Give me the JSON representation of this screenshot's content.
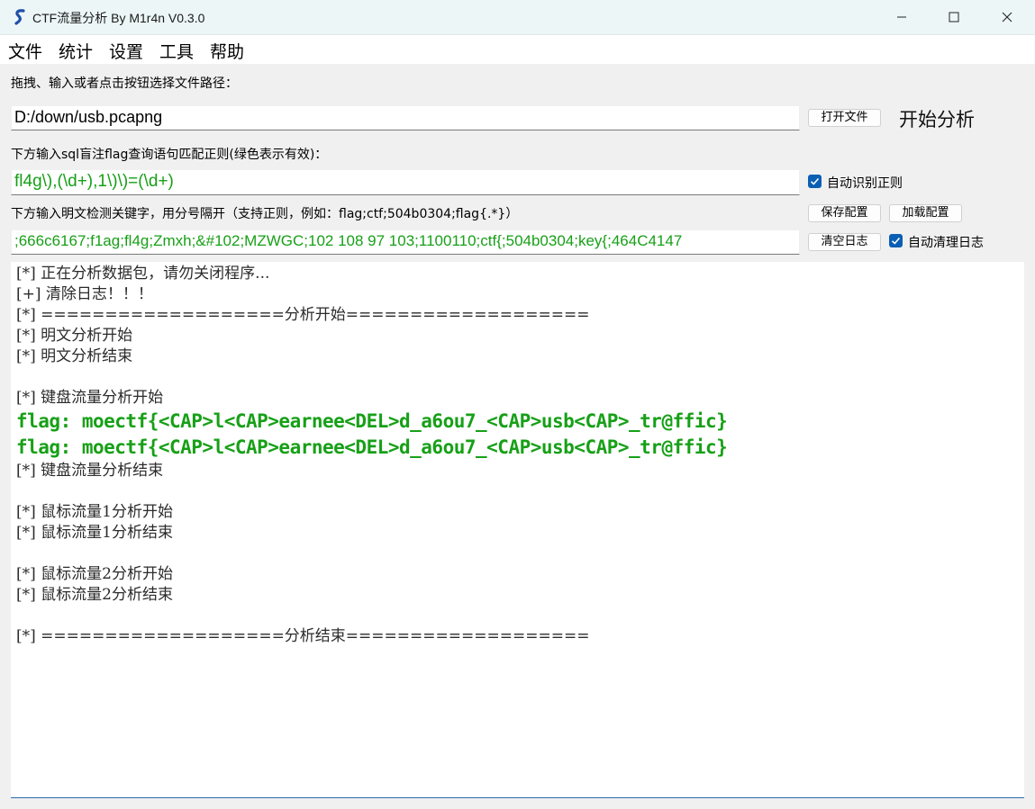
{
  "window": {
    "title": "CTF流量分析 By M1r4n V0.3.0",
    "controls": [
      "minimize",
      "maximize",
      "close"
    ]
  },
  "menu": {
    "items": [
      "文件",
      "统计",
      "设置",
      "工具",
      "帮助"
    ]
  },
  "file_section": {
    "label": "拖拽、输入或者点击按钮选择文件路径：",
    "path_value": "D:/down/usb.pcapng",
    "open_button": "打开文件",
    "start_button": "开始分析"
  },
  "sql_section": {
    "label": "下方输入sql盲注flag查询语句匹配正则(绿色表示有效)：",
    "regex_value": "fl4g\\),(\\d+),1\\)\\)=(\\d+)",
    "auto_regex_label": "自动识别正则",
    "auto_regex_checked": true
  },
  "keyword_section": {
    "label": "下方输入明文检测关键字，用分号隔开（支持正则，例如：flag;ctf;504b0304;flag{.*}）",
    "save_button": "保存配置",
    "load_button": "加载配置",
    "keywords_value": ";666c6167;f1ag;fl4g;Zmxh;&#102;MZWGC;102 108 97 103;1100110;ctf{;504b0304;key{;464C4147",
    "clear_log_button": "清空日志",
    "auto_clear_label": "自动清理日志",
    "auto_clear_checked": true
  },
  "colors": {
    "valid_green": "#17a017",
    "checkbox_blue": "#0a5fb4",
    "titlebar": "#ecf6f7"
  },
  "log": {
    "lines": [
      {
        "text": "[*] 正在分析数据包，请勿关闭程序...",
        "type": "normal"
      },
      {
        "text": "[+] 清除日志！！！",
        "type": "normal"
      },
      {
        "text": "[*] ===================分析开始===================",
        "type": "normal"
      },
      {
        "text": "[*] 明文分析开始",
        "type": "normal"
      },
      {
        "text": "[*] 明文分析结束",
        "type": "normal"
      },
      {
        "text": "",
        "type": "normal"
      },
      {
        "text": "[*] 键盘流量分析开始",
        "type": "normal"
      },
      {
        "text": "flag: moectf{<CAP>l<CAP>earnee<DEL>d_a6ou7_<CAP>usb<CAP>_tr@ffic}",
        "type": "flag"
      },
      {
        "text": "flag: moectf{<CAP>l<CAP>earnee<DEL>d_a6ou7_<CAP>usb<CAP>_tr@ffic}",
        "type": "flag"
      },
      {
        "text": "[*] 键盘流量分析结束",
        "type": "normal"
      },
      {
        "text": "",
        "type": "normal"
      },
      {
        "text": "[*] 鼠标流量1分析开始",
        "type": "normal"
      },
      {
        "text": "[*] 鼠标流量1分析结束",
        "type": "normal"
      },
      {
        "text": "",
        "type": "normal"
      },
      {
        "text": "[*] 鼠标流量2分析开始",
        "type": "normal"
      },
      {
        "text": "[*] 鼠标流量2分析结束",
        "type": "normal"
      },
      {
        "text": "",
        "type": "normal"
      },
      {
        "text": "[*] ===================分析结束===================",
        "type": "normal"
      }
    ]
  }
}
